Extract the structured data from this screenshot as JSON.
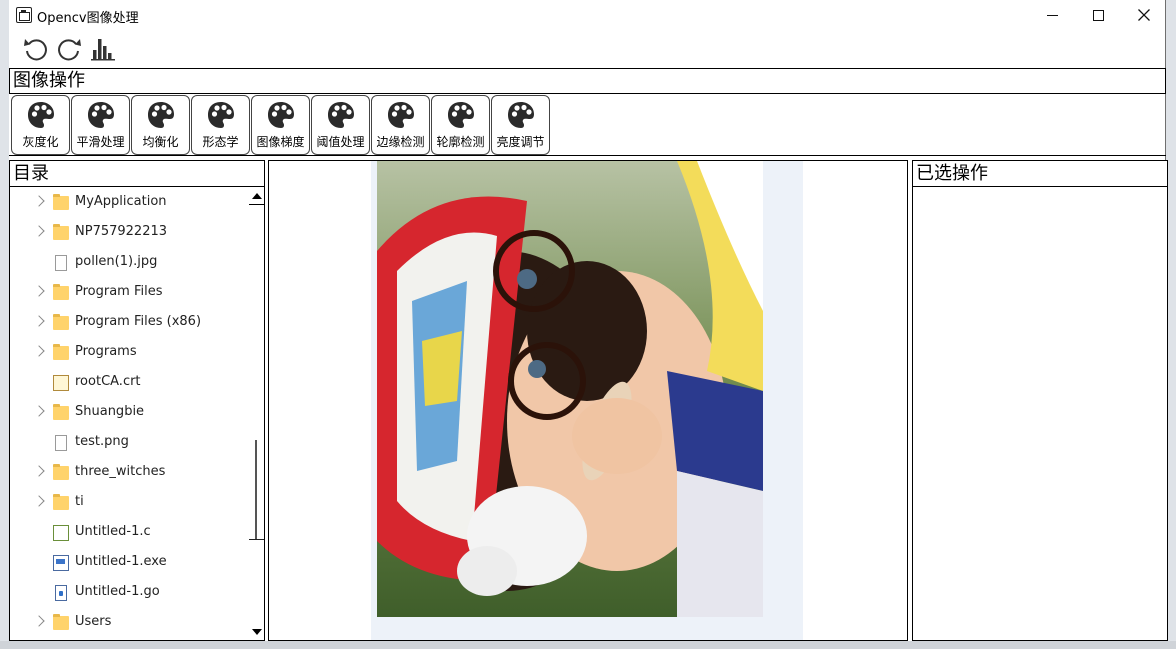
{
  "window": {
    "title": "Opencv图像处理",
    "minimize_label": "Minimize",
    "maximize_label": "Maximize",
    "close_label": "Close"
  },
  "toolbar": {
    "items": [
      {
        "icon": "undo-icon"
      },
      {
        "icon": "redo-icon"
      },
      {
        "icon": "histogram-icon"
      }
    ]
  },
  "operations": {
    "group_title": "图像操作",
    "buttons": [
      {
        "label": "灰度化",
        "icon": "palette-icon"
      },
      {
        "label": "平滑处理",
        "icon": "palette-icon"
      },
      {
        "label": "均衡化",
        "icon": "palette-icon"
      },
      {
        "label": "形态学",
        "icon": "palette-icon"
      },
      {
        "label": "图像梯度",
        "icon": "palette-icon"
      },
      {
        "label": "阈值处理",
        "icon": "palette-icon"
      },
      {
        "label": "边缘检测",
        "icon": "palette-icon"
      },
      {
        "label": "轮廓检测",
        "icon": "palette-icon"
      },
      {
        "label": "亮度调节",
        "icon": "palette-icon"
      }
    ]
  },
  "directory": {
    "title": "目录",
    "items": [
      {
        "name": "MyApplication",
        "type": "folder"
      },
      {
        "name": "NP757922213",
        "type": "folder"
      },
      {
        "name": "pollen(1).jpg",
        "type": "file"
      },
      {
        "name": "Program Files",
        "type": "folder"
      },
      {
        "name": "Program Files (x86)",
        "type": "folder"
      },
      {
        "name": "Programs",
        "type": "folder"
      },
      {
        "name": "rootCA.crt",
        "type": "cert"
      },
      {
        "name": "Shuangbie",
        "type": "folder"
      },
      {
        "name": "test.png",
        "type": "file"
      },
      {
        "name": "three_witches",
        "type": "folder"
      },
      {
        "name": "ti",
        "type": "folder"
      },
      {
        "name": "Untitled-1.c",
        "type": "cfile"
      },
      {
        "name": "Untitled-1.exe",
        "type": "exe"
      },
      {
        "name": "Untitled-1.go",
        "type": "gofile"
      },
      {
        "name": "Users",
        "type": "folder"
      }
    ]
  },
  "selected_ops": {
    "title": "已选操作"
  },
  "colors": {
    "folder": "#ffd36b",
    "border": "#000000",
    "frame_bg": "#edf2f9"
  }
}
